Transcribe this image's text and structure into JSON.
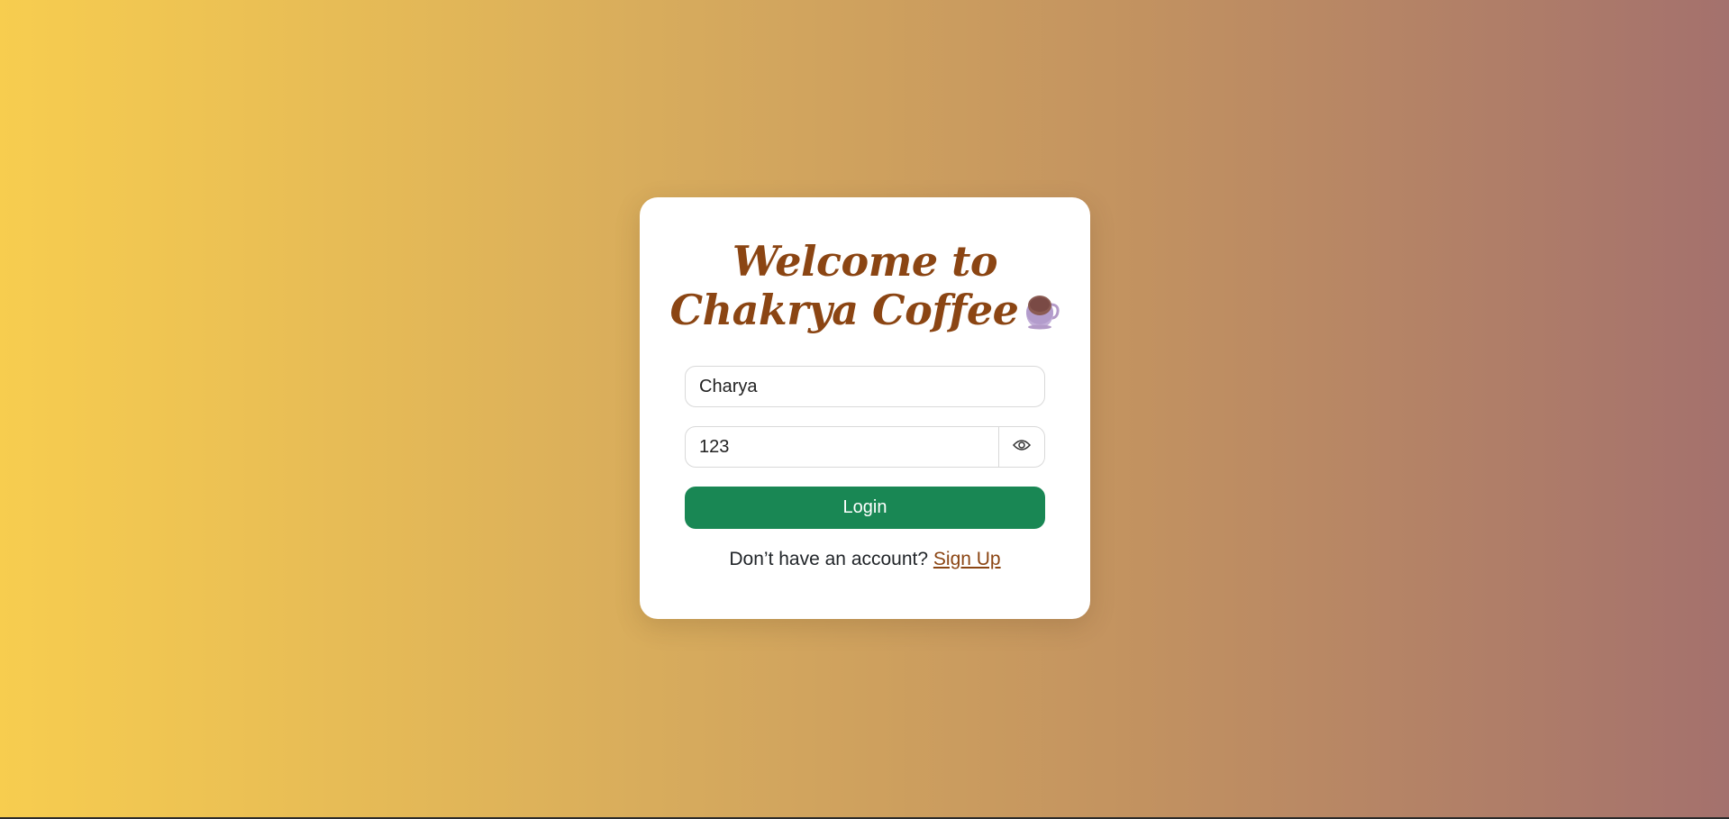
{
  "login": {
    "title": "Welcome to Chakrya Coffee",
    "title_icon": "coffee-cup-icon",
    "username": {
      "value": "Charya",
      "placeholder": ""
    },
    "password": {
      "value": "123",
      "placeholder": "",
      "toggle_icon": "eye-icon"
    },
    "login_button": "Login",
    "signup_prompt": "Don’t have an account?",
    "signup_link": "Sign Up"
  },
  "colors": {
    "background_start": "#f7cd4f",
    "background_end": "#a4716d",
    "title": "#8b4513",
    "button": "#198754",
    "link": "#8b4513",
    "card": "#ffffff"
  }
}
